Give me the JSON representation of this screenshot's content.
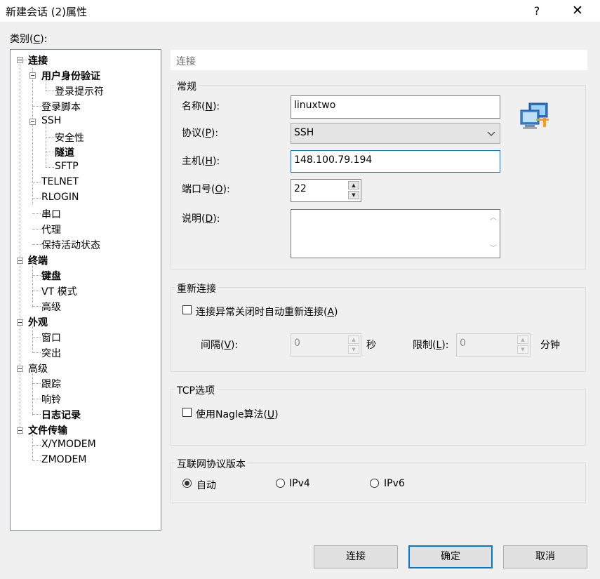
{
  "window": {
    "title": "新建会话 (2)属性",
    "help_label": "?",
    "close_label": "✕"
  },
  "category_label": "类别(C):",
  "tree": [
    {
      "label": "连接",
      "bold": true
    },
    {
      "label": "用户身份验证",
      "bold": true
    },
    {
      "label": "登录提示符",
      "bold": false
    },
    {
      "label": "登录脚本",
      "bold": false
    },
    {
      "label": "SSH",
      "bold": false
    },
    {
      "label": "安全性",
      "bold": false
    },
    {
      "label": "隧道",
      "bold": true
    },
    {
      "label": "SFTP",
      "bold": false
    },
    {
      "label": "TELNET",
      "bold": false
    },
    {
      "label": "RLOGIN",
      "bold": false
    },
    {
      "label": "串口",
      "bold": false
    },
    {
      "label": "代理",
      "bold": false
    },
    {
      "label": "保持活动状态",
      "bold": false
    },
    {
      "label": "终端",
      "bold": true
    },
    {
      "label": "键盘",
      "bold": true
    },
    {
      "label": "VT 模式",
      "bold": false
    },
    {
      "label": "高级",
      "bold": false
    },
    {
      "label": "外观",
      "bold": true
    },
    {
      "label": "窗口",
      "bold": false
    },
    {
      "label": "突出",
      "bold": false
    },
    {
      "label": "高级",
      "bold": false
    },
    {
      "label": "跟踪",
      "bold": false
    },
    {
      "label": "响铃",
      "bold": false
    },
    {
      "label": "日志记录",
      "bold": true
    },
    {
      "label": "文件传输",
      "bold": true
    },
    {
      "label": "X/YMODEM",
      "bold": false
    },
    {
      "label": "ZMODEM",
      "bold": false
    }
  ],
  "header": "连接",
  "general": {
    "title": "常规",
    "name_label": "名称(N):",
    "name_value": "linuxtwo",
    "protocol_label": "协议(P):",
    "protocol_value": "SSH",
    "host_label": "主机(H):",
    "host_value": "148.100.79.194",
    "port_label": "端口号(O):",
    "port_value": "22",
    "desc_label": "说明(D):",
    "desc_value": "",
    "icon": "network-computers-icon"
  },
  "reconnect": {
    "title": "重新连接",
    "checkbox_label": "连接异常关闭时自动重新连接(A)",
    "checked": false,
    "interval_label": "间隔(V):",
    "interval_value": "0",
    "interval_unit": "秒",
    "limit_label": "限制(L):",
    "limit_value": "0",
    "limit_unit": "分钟"
  },
  "tcp": {
    "title": "TCP选项",
    "nagle_label": "使用Nagle算法(U)",
    "checked": false
  },
  "ip": {
    "title": "互联网协议版本",
    "options": [
      "自动",
      "IPv4",
      "IPv6"
    ],
    "selected": "自动"
  },
  "buttons": {
    "connect": "连接",
    "ok": "确定",
    "cancel": "取消"
  },
  "colors": {
    "accent": "#0078d7",
    "background": "#f0f0f0"
  }
}
